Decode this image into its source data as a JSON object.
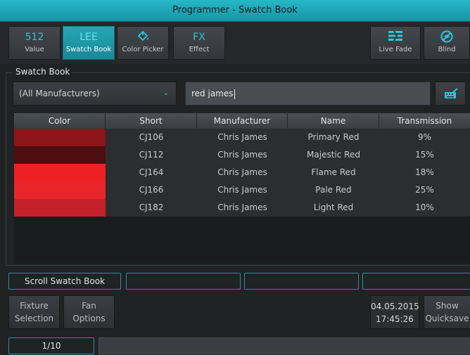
{
  "window": {
    "title": "Programmer - Swatch Book"
  },
  "toolbar": {
    "buttons": [
      {
        "top": "512",
        "label": "Value"
      },
      {
        "top": "LEE",
        "label": "Swatch Book"
      },
      {
        "icon": "paint-bucket-icon",
        "label": "Color Picker"
      },
      {
        "top": "FX",
        "label": "Effect"
      },
      {
        "icon": "live-fade-icon",
        "label": "Live Fade"
      },
      {
        "icon": "blind-icon",
        "label": "Blind"
      }
    ]
  },
  "panel": {
    "title": "Swatch Book"
  },
  "filter": {
    "manufacturer": "(All Manufacturers)",
    "search_value": "red james"
  },
  "table": {
    "columns": [
      "Color",
      "Short",
      "Manufacturer",
      "Name",
      "Transmission"
    ],
    "rows": [
      {
        "color": "#8b1518",
        "short": "CJ106",
        "manufacturer": "Chris James",
        "name": "Primary Red",
        "transmission": "9%"
      },
      {
        "color": "#4e0d10",
        "short": "CJ112",
        "manufacturer": "Chris James",
        "name": "Majestic Red",
        "transmission": "15%"
      },
      {
        "color": "#ee2024",
        "short": "CJ164",
        "manufacturer": "Chris James",
        "name": "Flame Red",
        "transmission": "18%"
      },
      {
        "color": "#e8262a",
        "short": "CJ166",
        "manufacturer": "Chris James",
        "name": "Pale Red",
        "transmission": "25%"
      },
      {
        "color": "#c4212a",
        "short": "CJ182",
        "manufacturer": "Chris James",
        "name": "Light Red",
        "transmission": "10%"
      }
    ]
  },
  "encoders": {
    "labels": [
      "Scroll Swatch Book",
      "",
      "",
      ""
    ]
  },
  "bottom": {
    "fixture_selection": [
      "Fixture",
      "Selection"
    ],
    "fan_options": [
      "Fan",
      "Options"
    ],
    "date": "04.05.2015",
    "time": "17:45:26",
    "show_quicksave": [
      "Show",
      "Quicksave"
    ],
    "page": "1/10"
  },
  "colors": {
    "accent": "#1fa8b8",
    "title_bar": "#22b0c0"
  }
}
